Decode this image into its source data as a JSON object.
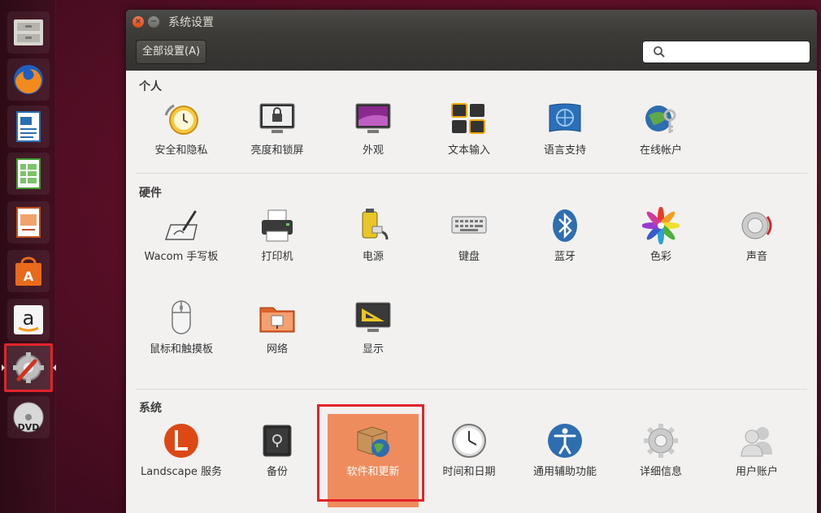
{
  "window": {
    "title": "系统设置",
    "close_glyph": "×",
    "minimize_glyph": "−",
    "all_settings_label": "全部设置(A)",
    "search_placeholder": ""
  },
  "launcher": [
    {
      "name": "files-launcher-icon"
    },
    {
      "name": "firefox-launcher-icon"
    },
    {
      "name": "writer-launcher-icon"
    },
    {
      "name": "calc-launcher-icon"
    },
    {
      "name": "impress-launcher-icon"
    },
    {
      "name": "software-center-launcher-icon"
    },
    {
      "name": "amazon-launcher-icon",
      "glyph": "a"
    },
    {
      "name": "system-settings-launcher-icon",
      "active": true
    },
    {
      "name": "dvd-launcher-icon",
      "glyph": "DVD"
    }
  ],
  "sections": {
    "personal": {
      "title": "个人",
      "items": [
        "安全和隐私",
        "亮度和锁屏",
        "外观",
        "文本输入",
        "语言支持",
        "在线帐户"
      ]
    },
    "hardware": {
      "title": "硬件",
      "items": [
        "Wacom 手写板",
        "打印机",
        "电源",
        "键盘",
        "蓝牙",
        "色彩",
        "声音",
        "鼠标和触摸板",
        "网络",
        "显示"
      ]
    },
    "system": {
      "title": "系统",
      "items": [
        "Landscape 服务",
        "备份",
        "软件和更新",
        "时间和日期",
        "通用辅助功能",
        "详细信息",
        "用户账户"
      ],
      "selected": "软件和更新"
    }
  },
  "colors": {
    "accent": "#ef8c5e",
    "highlight": "#e2232b",
    "ubuntu_orange": "#dd4814"
  }
}
